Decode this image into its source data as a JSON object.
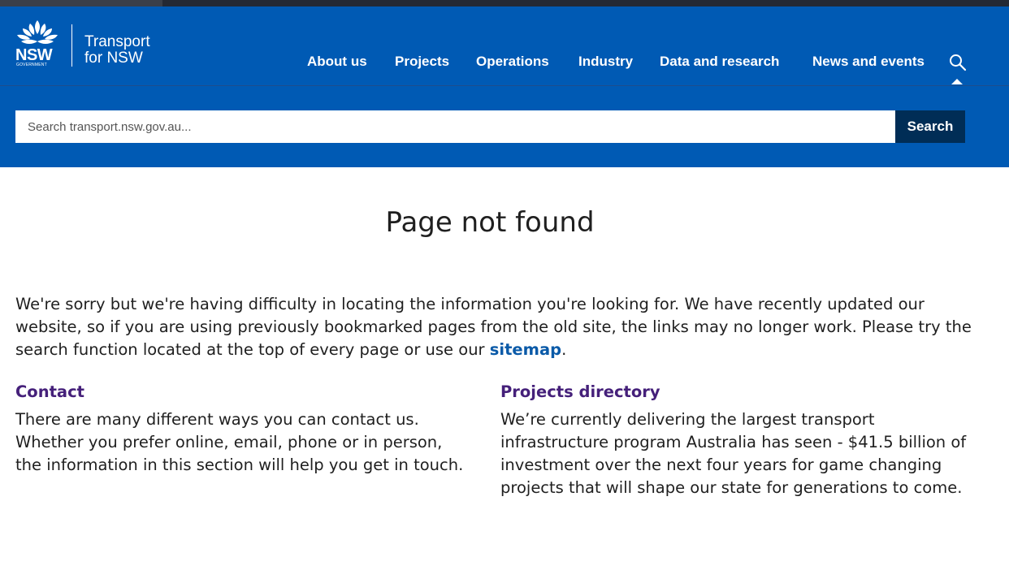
{
  "colors": {
    "header_bg": "#005ab4",
    "top_strip": "#242934",
    "search_button_bg": "#002d56",
    "heading_purple": "#45207a",
    "link_blue": "#0a5aa8"
  },
  "logo": {
    "emblem_icon": "waratah-icon",
    "nsw": "NSW",
    "government": "GOVERNMENT",
    "brand_line1": "Transport",
    "brand_line2": "for NSW"
  },
  "nav": {
    "items": [
      {
        "label": "About us"
      },
      {
        "label": "Projects"
      },
      {
        "label": "Operations"
      },
      {
        "label": "Industry"
      },
      {
        "label": "Data and research"
      },
      {
        "label": "News and events"
      }
    ],
    "search_icon": "search-icon"
  },
  "search": {
    "placeholder": "Search transport.nsw.gov.au...",
    "value": "",
    "button_label": "Search"
  },
  "main": {
    "title": "Page not found",
    "intro": "We're sorry but we're having difficulty in locating the information you're looking for. We have recently updated our website, so if you are using previously bookmarked pages from the old site, the links may no longer work. Please try the search function located at the top of every page or use our",
    "intro_link": "sitemap",
    "intro_end": ".",
    "columns": [
      {
        "heading": "Contact",
        "text": "There are many different ways you can contact us. Whether you prefer online, email, phone or in person, the information in this section will help you get in touch."
      },
      {
        "heading": "Projects directory",
        "text": "We’re currently delivering the largest transport infrastructure program Australia has seen - $41.5 billion of investment over the next four years for game changing projects that will shape our state for generations to come."
      }
    ]
  }
}
